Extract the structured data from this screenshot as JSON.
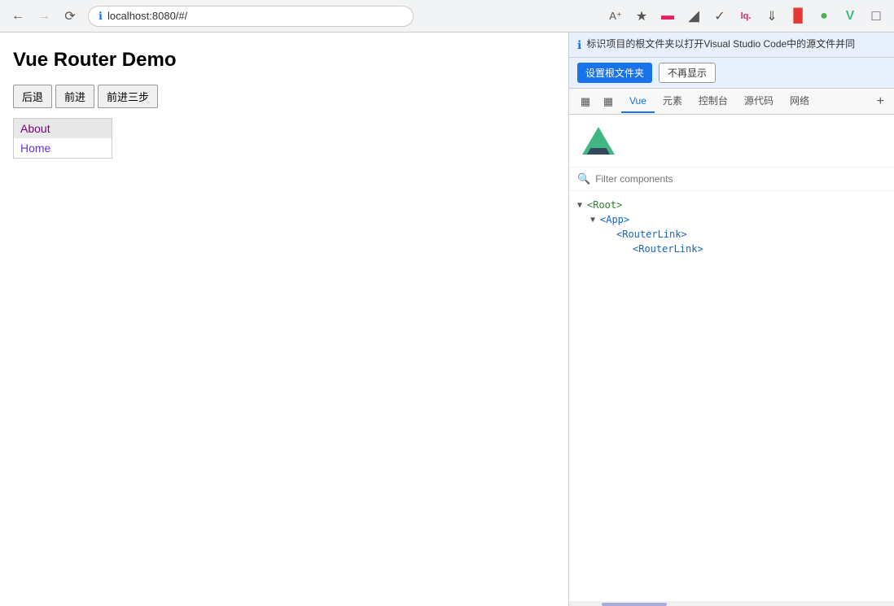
{
  "browser": {
    "url": "localhost:8080/#/",
    "back_disabled": false,
    "forward_disabled": true,
    "reload_label": "↻"
  },
  "page": {
    "title": "Vue Router Demo",
    "buttons": [
      {
        "label": "后退"
      },
      {
        "label": "前进"
      },
      {
        "label": "前进三步"
      }
    ],
    "nav_links": [
      {
        "label": "About",
        "active": true
      },
      {
        "label": "Home",
        "active": false
      }
    ]
  },
  "devtools": {
    "info_message": "标识项目的根文件夹以打开Visual Studio Code中的源文件并同",
    "set_root_label": "设置根文件夹",
    "dismiss_label": "不再显示",
    "tabs": [
      {
        "label": "Vue",
        "active": true
      },
      {
        "label": "元素",
        "active": false
      },
      {
        "label": "控制台",
        "active": false
      },
      {
        "label": "源代码",
        "active": false
      },
      {
        "label": "网络",
        "active": false
      }
    ],
    "filter_placeholder": "Filter components",
    "component_tree": [
      {
        "label": "▼",
        "tag": "<Root>",
        "indent": 0
      },
      {
        "label": "▼",
        "tag": "<App>",
        "indent": 1
      },
      {
        "label": "",
        "tag": "<RouterLink>",
        "indent": 2
      },
      {
        "label": "",
        "tag": "<RouterLink>",
        "indent": 3
      }
    ]
  },
  "icons": {
    "info": "ℹ",
    "search": "🔍",
    "vue_chevron": "▼",
    "plus": "+"
  }
}
